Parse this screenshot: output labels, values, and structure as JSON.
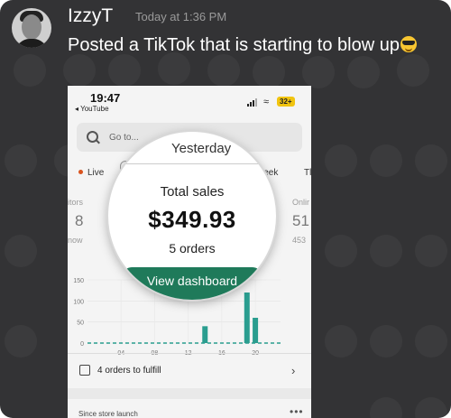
{
  "post": {
    "username": "IzzyT",
    "timestamp": "Today at 1:36 PM",
    "message": "Posted a TikTok that is starting to blow up",
    "emoji": "sunglasses-emoji"
  },
  "screenshot": {
    "status_bar": {
      "time": "19:47",
      "back_label": "◂ YouTube",
      "battery": "32+"
    },
    "search": {
      "placeholder": "Go to..."
    },
    "chips": {
      "live": "Live",
      "this_week": "is week",
      "next_tab": "Tl"
    },
    "stats": {
      "left_label": "itors",
      "left_value": "8",
      "left_sub": "now",
      "right_label": "Onlir",
      "right_value": "51",
      "right_sub": "453"
    },
    "chart_data": {
      "type": "bar",
      "x": [
        0,
        2,
        4,
        6,
        8,
        10,
        12,
        14,
        16,
        18,
        19,
        20
      ],
      "values": [
        0,
        0,
        0,
        0,
        0,
        0,
        0,
        40,
        0,
        0,
        120,
        60
      ],
      "bar_x": [
        14,
        19,
        20
      ],
      "bar_values": [
        40,
        120,
        60
      ],
      "xticks": [
        "04",
        "08",
        "12",
        "16",
        "20"
      ],
      "yticks": [
        "0",
        "50",
        "100",
        "150"
      ],
      "ylim": [
        0,
        150
      ],
      "xlim": [
        0,
        23
      ],
      "series_color": "#2a9d8f",
      "baseline": "dashed"
    },
    "fulfill": {
      "label": "4 orders to fulfill"
    },
    "since": {
      "label": "Since store launch"
    },
    "magnifier": {
      "yesterday": "Yesterday",
      "total_sales_label": "Total sales",
      "total_sales_value": "$349.93",
      "orders": "5 orders",
      "button": "View dashboard"
    }
  }
}
